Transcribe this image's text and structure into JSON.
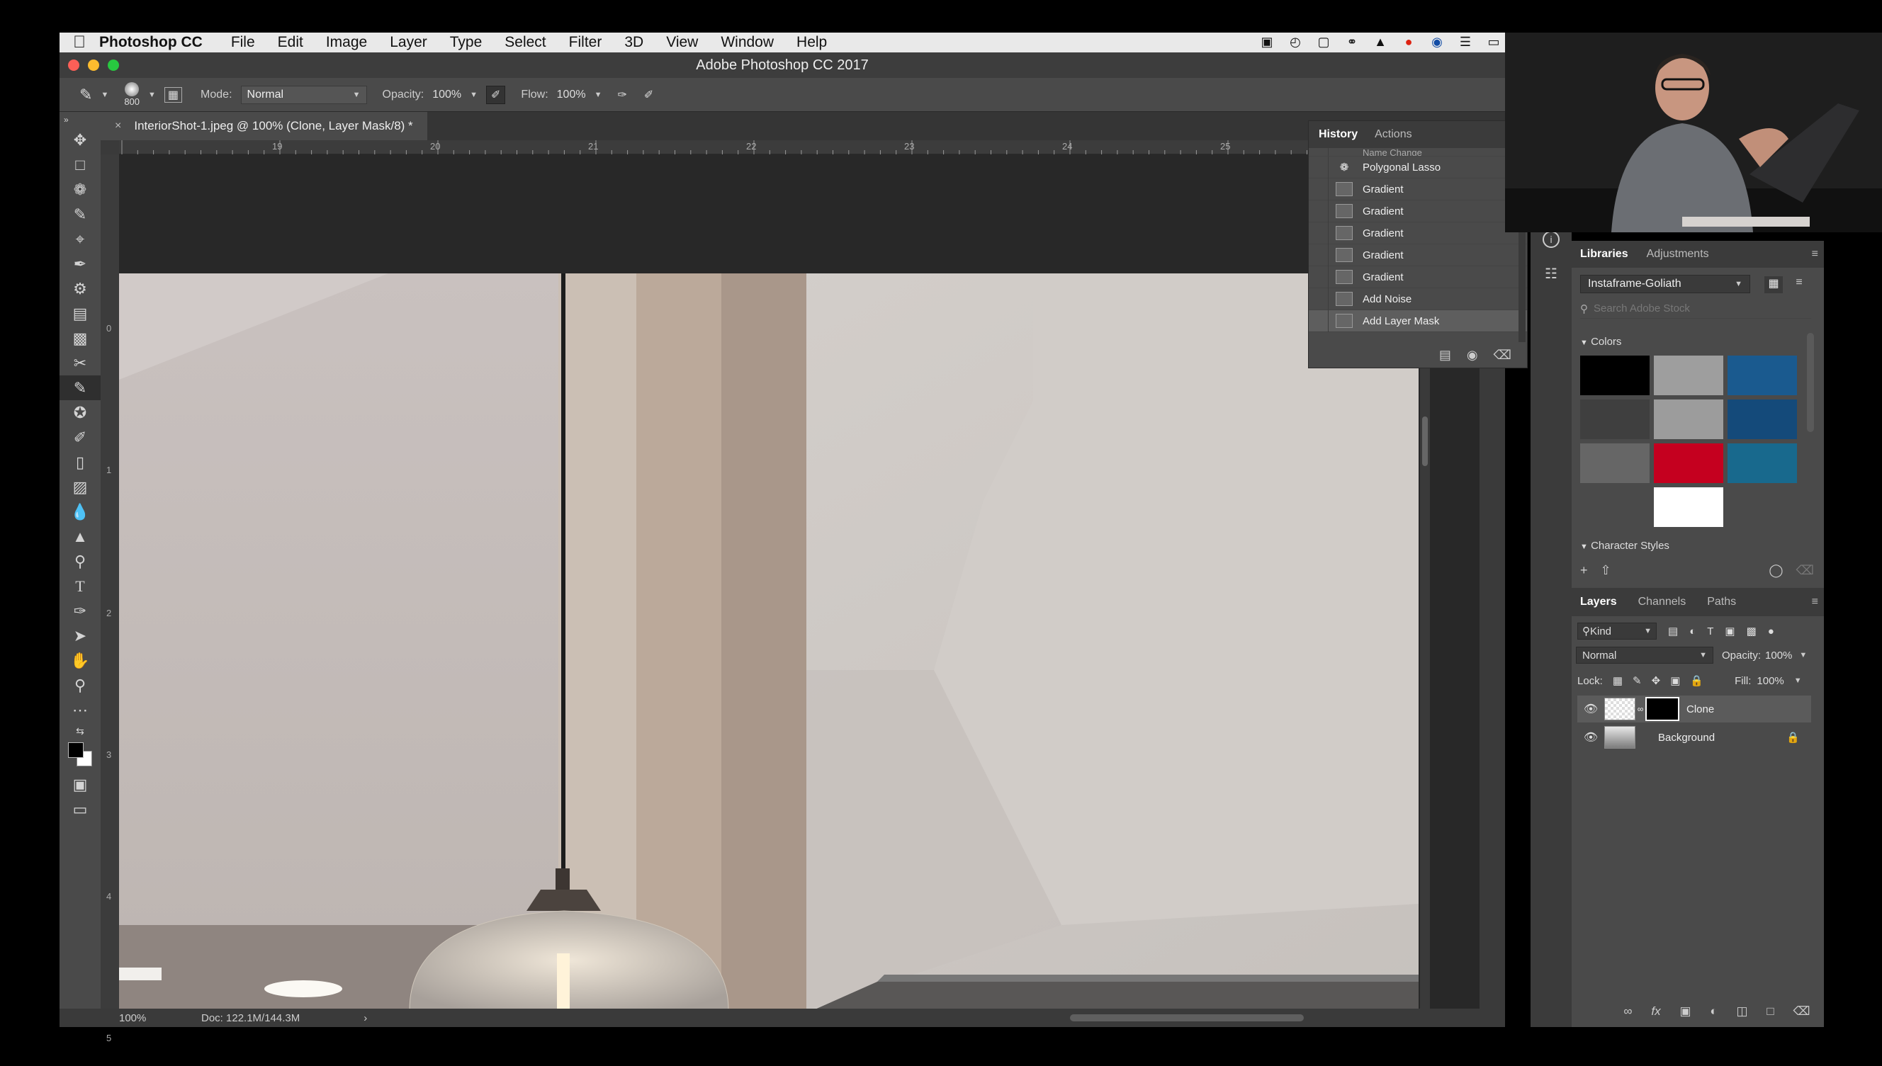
{
  "menubar": {
    "app_name": "Photoshop CC",
    "items": [
      "File",
      "Edit",
      "Image",
      "Layer",
      "Type",
      "Select",
      "Filter",
      "3D",
      "View",
      "Window",
      "Help"
    ]
  },
  "window": {
    "title": "Adobe Photoshop CC 2017"
  },
  "options": {
    "brush_size": "800",
    "mode_label": "Mode:",
    "mode_value": "Normal",
    "opacity_label": "Opacity:",
    "opacity_value": "100%",
    "flow_label": "Flow:",
    "flow_value": "100%"
  },
  "document": {
    "tab_title": "InteriorShot-1.jpeg @ 100% (Clone, Layer Mask/8) *",
    "ruler_h": [
      "19",
      "20",
      "21",
      "22",
      "23",
      "24",
      "25"
    ],
    "ruler_v": [
      "0",
      "1",
      "2",
      "3",
      "4",
      "5"
    ]
  },
  "status": {
    "zoom": "100%",
    "doc": "Doc: 122.1M/144.3M"
  },
  "history": {
    "tabs": [
      "History",
      "Actions"
    ],
    "cut_row": "Name Change",
    "rows": [
      "Polygonal Lasso",
      "Gradient",
      "Gradient",
      "Gradient",
      "Gradient",
      "Gradient",
      "Add Noise",
      "Add Layer Mask"
    ]
  },
  "libraries": {
    "tabs": [
      "Libraries",
      "Adjustments"
    ],
    "library_name": "Instaframe-Goliath",
    "search_placeholder": "Search Adobe Stock",
    "colors_label": "Colors",
    "swatches": [
      "#000000",
      "#9e9e9e",
      "#1a5a8f",
      "#3f3f3f",
      "#9c9c9c",
      "#144a7a",
      "#666666",
      "#c5001f",
      "#18698d",
      "#4a4a4a",
      "#ffffff"
    ],
    "char_styles_label": "Character Styles"
  },
  "layers": {
    "tabs": [
      "Layers",
      "Channels",
      "Paths"
    ],
    "kind": "Kind",
    "blend_mode": "Normal",
    "opacity_label": "Opacity:",
    "opacity_value": "100%",
    "lock_label": "Lock:",
    "fill_label": "Fill:",
    "fill_value": "100%",
    "items": [
      {
        "name": "Clone"
      },
      {
        "name": "Background"
      }
    ]
  }
}
